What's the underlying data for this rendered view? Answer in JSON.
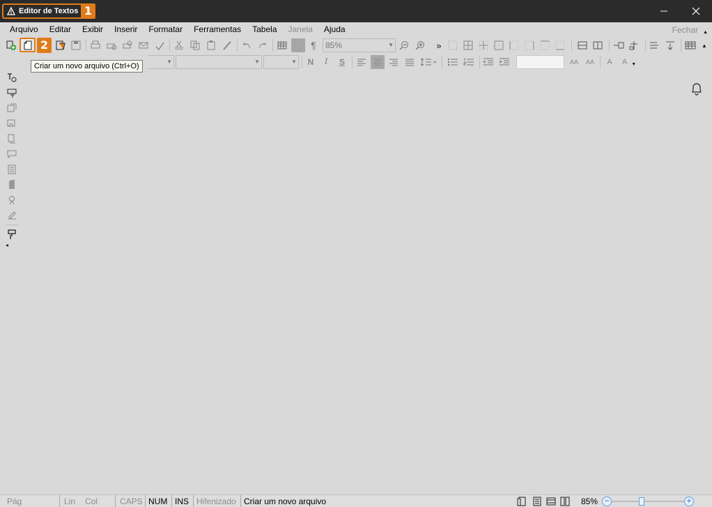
{
  "title_bar": {
    "app_title": "Editor de Textos",
    "badge": "1",
    "minimize": "—",
    "close": "✕"
  },
  "menu": {
    "items": [
      {
        "label": "Arquivo"
      },
      {
        "label": "Editar"
      },
      {
        "label": "Exibir"
      },
      {
        "label": "Inserir"
      },
      {
        "label": "Formatar"
      },
      {
        "label": "Ferramentas"
      },
      {
        "label": "Tabela"
      },
      {
        "label": "Janela"
      },
      {
        "label": "Ajuda"
      }
    ],
    "close_label": "Fechar"
  },
  "toolbar": {
    "new_badge": "2",
    "zoom_value": "85%",
    "pilcrow": "¶",
    "bold": "N",
    "italic": "I",
    "underline": "S",
    "more": "»",
    "text_a": "A",
    "text_aa": "AA",
    "style_text": "A"
  },
  "tooltip": {
    "text": "Criar um novo arquivo (Ctrl+O)"
  },
  "status_bar": {
    "page": "Pág",
    "line": "Lin",
    "col": "Col",
    "caps": "CAPS",
    "num": "NUM",
    "ins": "INS",
    "hyphen": "Hifenizado",
    "message": "Criar um novo arquivo",
    "zoom": "85%",
    "minus": "−",
    "plus": "+"
  },
  "colors": {
    "accent": "#e07b1a",
    "titlebar": "#2b2b2b",
    "background": "#d9d9d9"
  },
  "icons": [
    "app-icon",
    "new-file-icon",
    "open-icon",
    "save-icon",
    "print-icon",
    "cut-icon",
    "copy-icon",
    "paste-icon",
    "undo-icon",
    "redo-icon",
    "table-icon",
    "zoom-in-icon",
    "zoom-out-icon",
    "bell-icon"
  ]
}
